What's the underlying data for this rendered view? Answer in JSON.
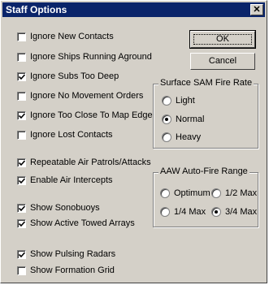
{
  "window": {
    "title": "Staff Options",
    "close_glyph": "✕"
  },
  "checkboxes": [
    {
      "label": "Ignore New Contacts",
      "checked": false
    },
    {
      "label": "Ignore Ships Running Aground",
      "checked": false
    },
    {
      "label": "Ignore Subs Too Deep",
      "checked": true
    },
    {
      "label": "Ignore No Movement Orders",
      "checked": false
    },
    {
      "label": "Ignore Too Close To Map Edge",
      "checked": true
    },
    {
      "label": "Ignore Lost Contacts",
      "checked": false
    },
    {
      "label": "Repeatable Air Patrols/Attacks",
      "checked": true
    },
    {
      "label": "Enable Air Intercepts",
      "checked": true
    },
    {
      "label": "Show Sonobuoys",
      "checked": true
    },
    {
      "label": "Show Active Towed Arrays",
      "checked": true
    },
    {
      "label": "Show Pulsing Radars",
      "checked": true
    },
    {
      "label": "Show Formation Grid",
      "checked": false
    }
  ],
  "buttons": {
    "ok": "OK",
    "cancel": "Cancel"
  },
  "sam_group": {
    "title": "Surface SAM Fire Rate",
    "options": [
      {
        "label": "Light",
        "selected": false
      },
      {
        "label": "Normal",
        "selected": true
      },
      {
        "label": "Heavy",
        "selected": false
      }
    ]
  },
  "aaw_group": {
    "title": "AAW Auto-Fire Range",
    "options": [
      {
        "label": "Optimum",
        "selected": false
      },
      {
        "label": "1/2 Max",
        "selected": false
      },
      {
        "label": "1/4 Max",
        "selected": false
      },
      {
        "label": "3/4 Max",
        "selected": true
      }
    ]
  }
}
